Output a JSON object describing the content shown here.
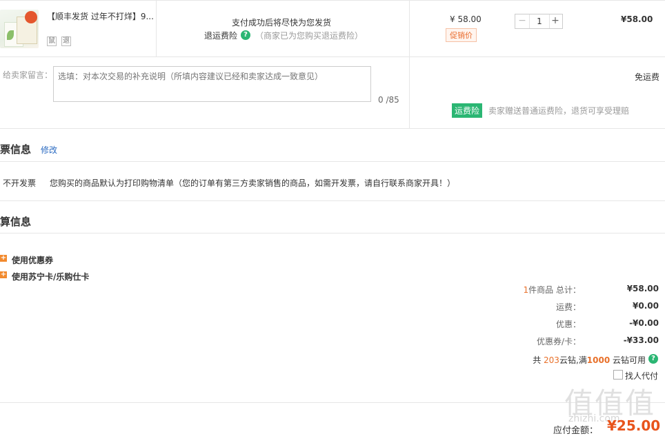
{
  "product": {
    "title": "【顺丰发货 过年不打烊】9...",
    "tag1": "鼠",
    "tag2": "退",
    "ship_note": "支付成功后将尽快为您发货",
    "insurance_label": "退运费险",
    "insurance_note": "（商家已为您购买退运费险）",
    "unit_price": "¥ 58.00",
    "promo_tag": "促销价",
    "quantity": "1",
    "minus_icon": "−",
    "plus_icon": "+",
    "total": "¥58.00"
  },
  "message": {
    "label": "给卖家留言：",
    "placeholder": "选填：对本次交易的补充说明（所填内容建议已经和卖家达成一致意见）",
    "count": "0 /85"
  },
  "shipping": {
    "fee": "免运费",
    "insurance_badge": "运费险",
    "insurance_note": "卖家赠送普通运费险，退货可享受理赔"
  },
  "invoice": {
    "title": "票信息",
    "edit": "修改",
    "type": "不开发票",
    "note": "您购买的商品默认为打印购物清单（您的订单有第三方卖家销售的商品，如需开发票，请自行联系商家开具！）"
  },
  "settlement": {
    "title": "算信息",
    "options": [
      "使用优惠券",
      "使用苏宁卡/乐购仕卡"
    ],
    "items_count": "1",
    "items_label": "件商品 总计：",
    "items_total": "¥58.00",
    "shipping_label": "运费：",
    "shipping_value": "¥0.00",
    "discount_label": "优惠：",
    "discount_value": "-¥0.00",
    "coupon_label": "优惠券/卡：",
    "coupon_value": "-¥33.00",
    "diamond_pre": "共 ",
    "diamond_count": "203",
    "diamond_mid": "云钻,满",
    "diamond_threshold": "1000",
    "diamond_post": " 云钻可用",
    "proxy_pay": "找人代付",
    "payable_label": "应付金额：",
    "payable_value": "¥25.00"
  },
  "watermark": {
    "mark": "值值值",
    "url": "zhizhi.com"
  },
  "icons": {
    "help": "?",
    "plus_square": "+"
  },
  "colors": {
    "accent_green": "#2bb673",
    "price_orange": "#e8541c",
    "link_blue": "#2b6bc2"
  }
}
